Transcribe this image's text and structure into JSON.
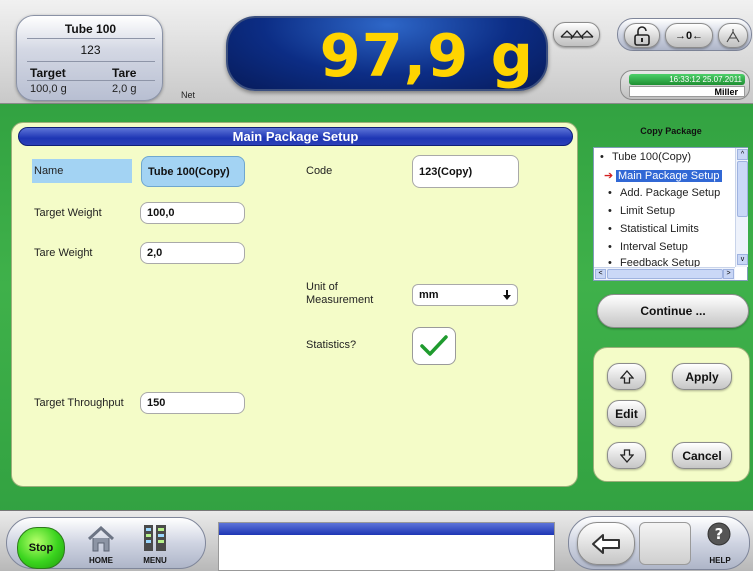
{
  "header": {
    "product_name": "Tube 100",
    "product_code": "123",
    "target_label": "Target",
    "target_value": "100,0 g",
    "tare_label": "Tare",
    "tare_value": "2,0 g",
    "net_label": "Net",
    "weight": "97,9 g",
    "zero_label": "→0←",
    "time_date": "16:33:12  25.07.2011",
    "user": "Miller"
  },
  "main": {
    "title": "Main Package Setup",
    "fields": {
      "name_label": "Name",
      "name_value": "Tube 100(Copy)",
      "code_label": "Code",
      "code_value": "123(Copy)",
      "target_weight_label": "Target Weight",
      "target_weight_value": "100,0",
      "tare_weight_label": "Tare Weight",
      "tare_weight_value": "2,0",
      "uom_label_1": "Unit of",
      "uom_label_2": "Measurement",
      "uom_value": "mm",
      "statistics_label": "Statistics?",
      "statistics_checked": true,
      "throughput_label": "Target Throughput",
      "throughput_value": "150"
    }
  },
  "right_panel": {
    "title": "Copy Package",
    "tree": [
      {
        "label": "Tube 100(Copy)",
        "level": 0,
        "selected": false
      },
      {
        "label": "Main Package Setup",
        "level": 1,
        "selected": true
      },
      {
        "label": "Add. Package Setup",
        "level": 1,
        "selected": false
      },
      {
        "label": "Limit Setup",
        "level": 1,
        "selected": false
      },
      {
        "label": "Statistical Limits",
        "level": 1,
        "selected": false
      },
      {
        "label": "Interval Setup",
        "level": 1,
        "selected": false
      },
      {
        "label": "Feedback Setup",
        "level": 1,
        "selected": false
      }
    ],
    "continue_label": "Continue ...",
    "apply_label": "Apply",
    "edit_label": "Edit",
    "cancel_label": "Cancel"
  },
  "bottom": {
    "stop_label": "Stop",
    "home_label": "HOME",
    "menu_label": "MENU",
    "help_label": "HELP"
  },
  "colors": {
    "background_green": "#3fb14a",
    "panel_bg": "#f4fcc8",
    "title_blue": "#1e36b4",
    "weight_yellow": "#ffd400",
    "selected_blue": "#3168d5",
    "check_green": "#1f9b2e"
  }
}
